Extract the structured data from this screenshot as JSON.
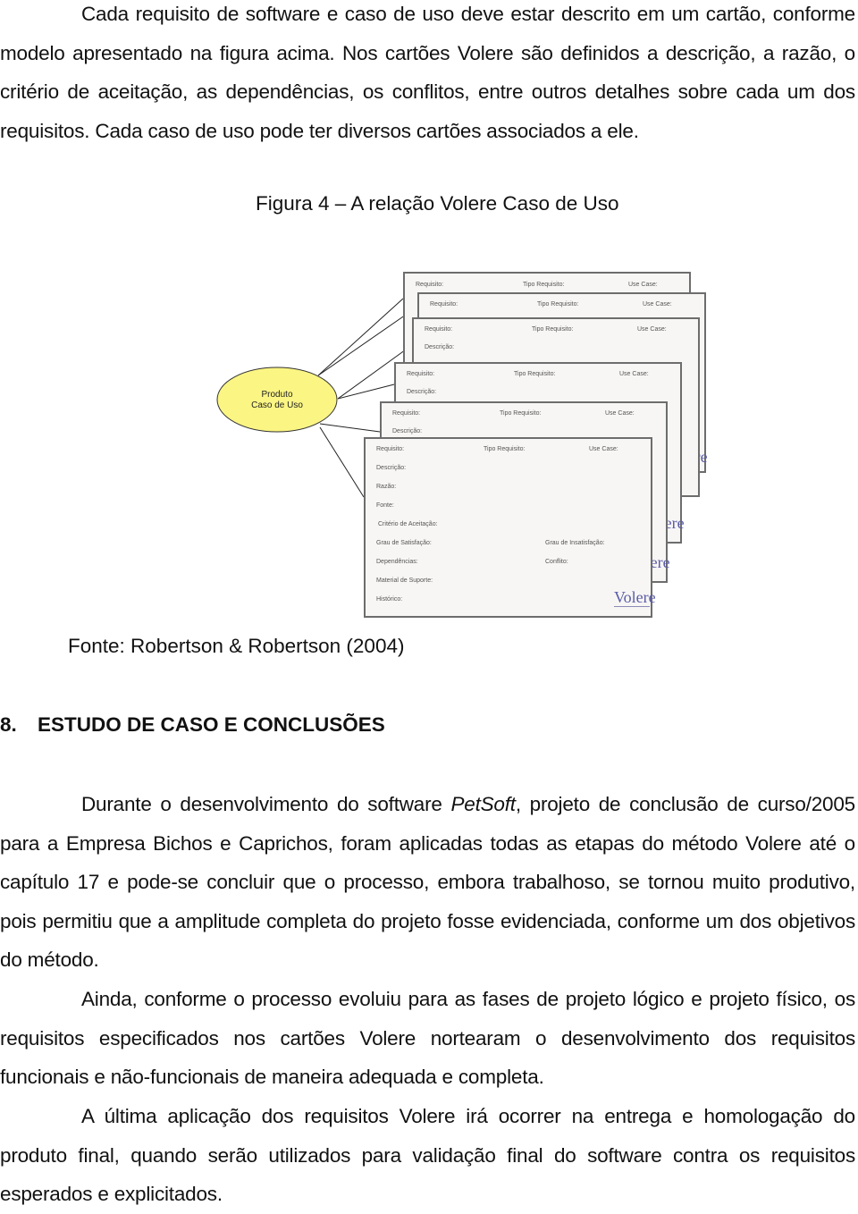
{
  "paragraph1": {
    "text": "Cada requisito de software e caso de uso deve estar descrito em um cartão, conforme modelo apresentado na figura acima.  Nos cartões Volere são definidos a descrição, a razão, o critério de aceitação, as dependências, os conflitos, entre outros detalhes sobre cada um dos requisitos. Cada caso de uso pode ter diversos cartões associados a ele."
  },
  "figure": {
    "title": "Figura 4 – A relação Volere Caso de Uso",
    "source": "Fonte: Robertson & Robertson (2004)",
    "ellipse": {
      "line1": "Produto",
      "line2": "Caso de Uso",
      "fill": "#fbf584"
    },
    "card_fields": {
      "requisito": "Requisito:",
      "tipo": "Tipo Requisito:",
      "use_case": "Use Case:",
      "descricao": "Descrição:",
      "razao": "Razão:",
      "fonte": "Fonte:",
      "criterio": "Critério de Aceitação:",
      "satisfacao": "Grau de Satisfação:",
      "insatisfacao": "Grau de Insatisfação:",
      "dependencias": "Dependências:",
      "conflito": "Conflito:",
      "material": "Material de Suporte:",
      "historico": "Histórico:"
    },
    "logo": "Volere",
    "logo_color": "#5a5ca8"
  },
  "section": {
    "number": "8.",
    "title": "ESTUDO DE CASO E CONCLUSÕES"
  },
  "paragraph2": {
    "before": "Durante o desenvolvimento do software ",
    "emphasis": "PetSoft",
    "after": ", projeto de conclusão de curso/2005 para a Empresa Bichos e Caprichos, foram aplicadas todas as etapas do método Volere até o capítulo 17 e pode-se concluir que o processo, embora trabalhoso, se tornou muito produtivo, pois permitiu que a amplitude completa do projeto fosse evidenciada, conforme um dos objetivos do método."
  },
  "paragraph3": {
    "text": "Ainda, conforme o processo evoluiu para as fases de projeto lógico e projeto físico, os requisitos especificados nos cartões Volere nortearam o desenvolvimento dos requisitos funcionais e não-funcionais de maneira adequada e completa."
  },
  "paragraph4": {
    "text": "A última aplicação dos requisitos Volere irá ocorrer na entrega e homologação do produto final, quando serão utilizados para validação final do software contra os requisitos esperados e explicitados."
  }
}
